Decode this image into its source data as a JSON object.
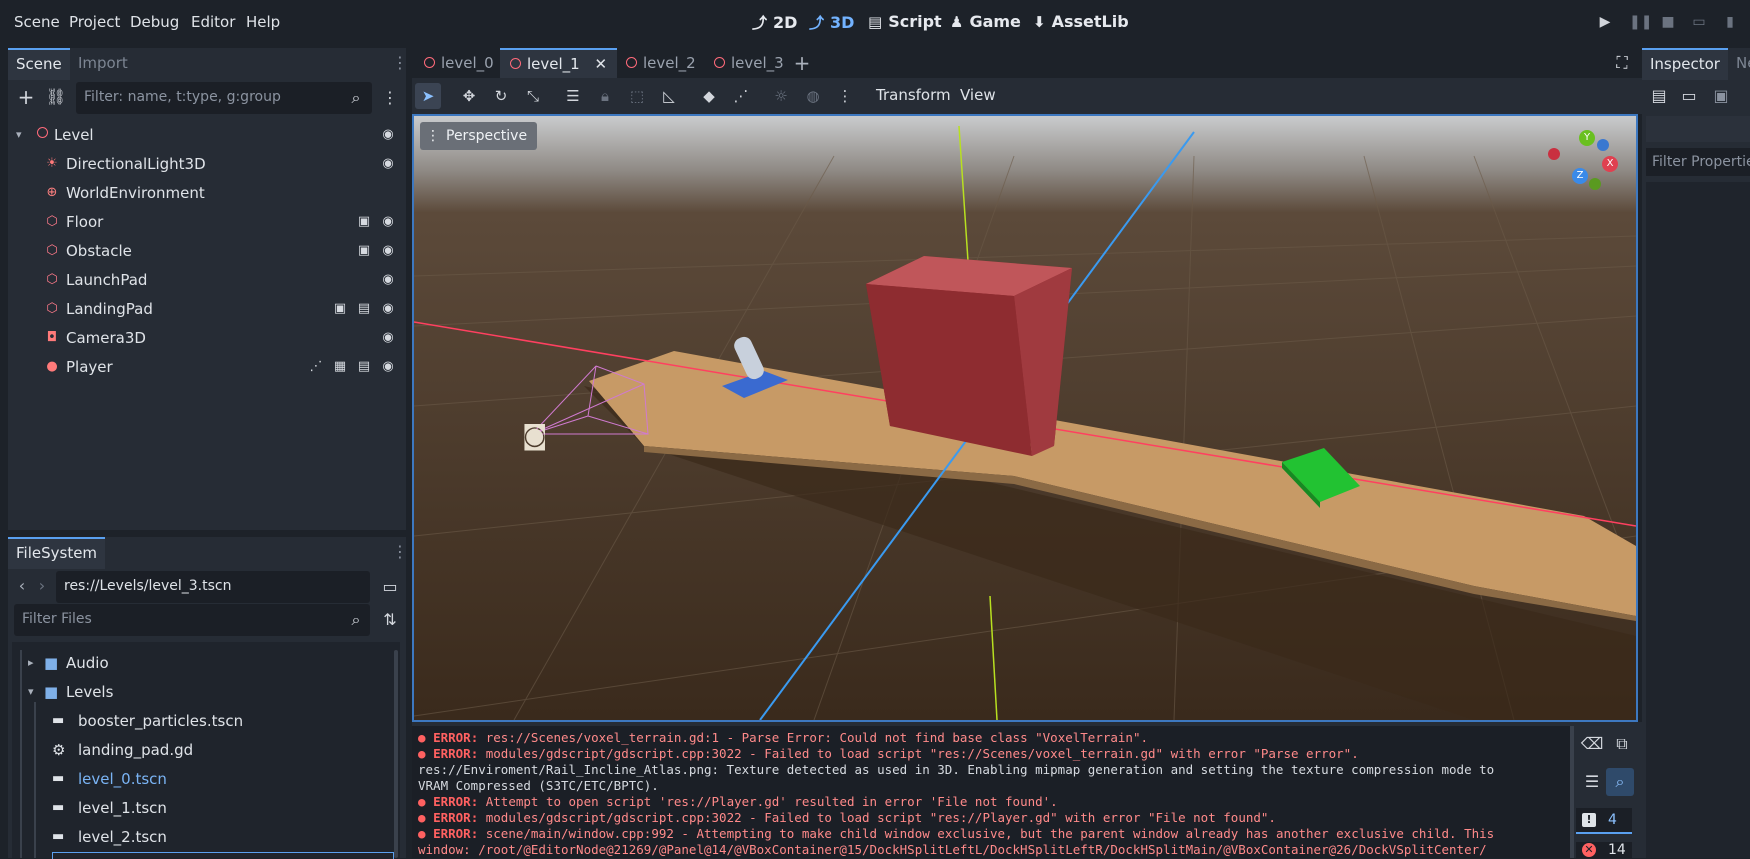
{
  "menu": [
    "Scene",
    "Project",
    "Debug",
    "Editor",
    "Help"
  ],
  "workspaces": [
    {
      "label": "2D",
      "icon": "2d-icon"
    },
    {
      "label": "3D",
      "icon": "3d-icon"
    },
    {
      "label": "Script",
      "icon": "script-icon"
    },
    {
      "label": "Game",
      "icon": "game-icon"
    },
    {
      "label": "AssetLib",
      "icon": "assetlib-icon"
    }
  ],
  "scene_dock": {
    "tabs": [
      "Scene",
      "Import"
    ],
    "filter_placeholder": "Filter: name, t:type, g:group",
    "nodes": [
      {
        "label": "Level",
        "icon": "node3d-icon"
      },
      {
        "label": "DirectionalLight3D",
        "icon": "light-icon"
      },
      {
        "label": "WorldEnvironment",
        "icon": "globe-icon"
      },
      {
        "label": "Floor",
        "icon": "mesh-icon"
      },
      {
        "label": "Obstacle",
        "icon": "mesh-icon"
      },
      {
        "label": "LaunchPad",
        "icon": "mesh-icon"
      },
      {
        "label": "LandingPad",
        "icon": "mesh-icon"
      },
      {
        "label": "Camera3D",
        "icon": "camera-icon"
      },
      {
        "label": "Player",
        "icon": "rigidbody-icon"
      }
    ]
  },
  "filesystem": {
    "tab": "FileSystem",
    "path": "res://Levels/level_3.tscn",
    "filter_placeholder": "Filter Files",
    "items": [
      {
        "label": "Audio",
        "type": "folder",
        "expanded": false
      },
      {
        "label": "Levels",
        "type": "folder",
        "expanded": true
      },
      {
        "label": "booster_particles.tscn",
        "type": "scene"
      },
      {
        "label": "landing_pad.gd",
        "type": "script"
      },
      {
        "label": "level_0.tscn",
        "type": "scene",
        "selected": true
      },
      {
        "label": "level_1.tscn",
        "type": "scene"
      },
      {
        "label": "level_2.tscn",
        "type": "scene"
      }
    ]
  },
  "editor_tabs": [
    "level_0",
    "level_1",
    "level_2",
    "level_3"
  ],
  "active_tab": "level_1",
  "viewport": {
    "menus": [
      "Transform",
      "View"
    ],
    "perspective_label": "Perspective",
    "gizmo_axes": [
      "Y",
      "X",
      "Z"
    ]
  },
  "inspector": {
    "tabs": [
      "Inspector",
      "Ne"
    ],
    "filter_placeholder": "Filter Properties"
  },
  "console": {
    "lines": [
      {
        "error": true,
        "tag": "ERROR:",
        "text": "res://Scenes/voxel_terrain.gd:1 - Parse Error: Could not find base class \"VoxelTerrain\"."
      },
      {
        "error": true,
        "tag": "ERROR:",
        "text": "modules/gdscript/gdscript.cpp:3022 - Failed to load script \"res://Scenes/voxel_terrain.gd\" with error \"Parse error\"."
      },
      {
        "error": false,
        "tag": "",
        "text": "res://Enviroment/Rail_Incline_Atlas.png: Texture detected as used in 3D. Enabling mipmap generation and setting the texture compression mode to"
      },
      {
        "error": false,
        "tag": "",
        "text": "VRAM Compressed (S3TC/ETC/BPTC)."
      },
      {
        "error": true,
        "tag": "ERROR:",
        "text": "Attempt to open script 'res://Player.gd' resulted in error 'File not found'."
      },
      {
        "error": true,
        "tag": "ERROR:",
        "text": "modules/gdscript/gdscript.cpp:3022 - Failed to load script \"res://Player.gd\" with error \"File not found\"."
      },
      {
        "error": true,
        "tag": "ERROR:",
        "text": "scene/main/window.cpp:992 - Attempting to make child window exclusive, but the parent window already has another exclusive child. This"
      },
      {
        "error": false,
        "tag": "",
        "text": "window: /root/@EditorNode@21269/@Panel@14/@VBoxContainer@15/DockHSplitLeftL/DockHSplitLeftR/DockHSplitMain/@VBoxContainer@26/DockVSplitCenter/"
      }
    ],
    "warning_count": "4",
    "error_count": "14"
  },
  "colors": {
    "accent": "#5aa0f0",
    "error": "#ff6161",
    "background": "#1d2229",
    "panel": "#262c35"
  }
}
